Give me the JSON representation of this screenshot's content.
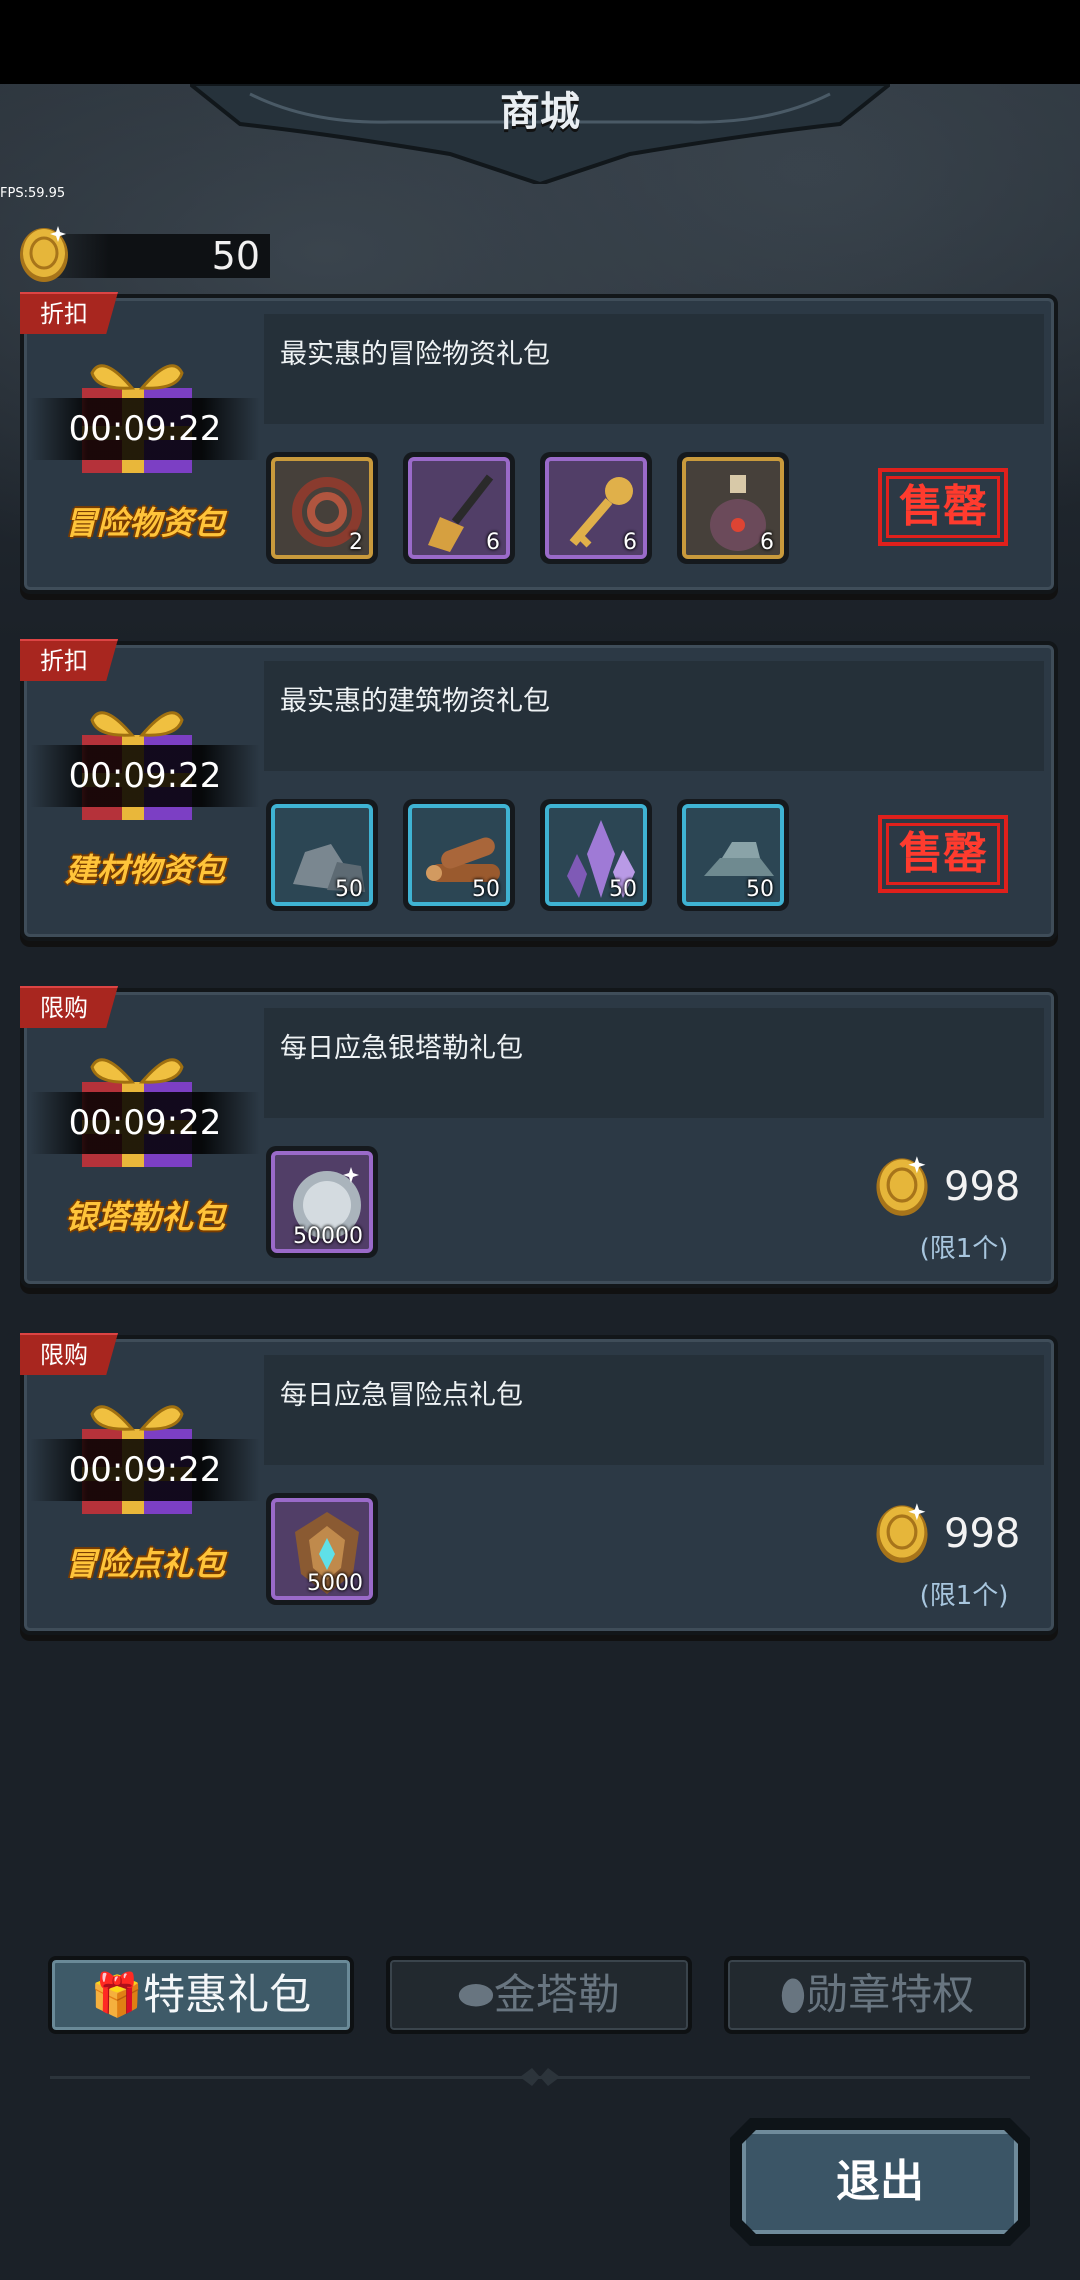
{
  "header": {
    "title": "商城",
    "fps": "FPS:59.95"
  },
  "currency": {
    "amount": "50",
    "icon": "gold-coin-icon"
  },
  "packs": [
    {
      "tag": "折扣",
      "timer": "00:09:22",
      "name": "冒险物资包",
      "description": "最实惠的冒险物资礼包",
      "items": [
        {
          "icon": "rope-icon",
          "count": "2",
          "frame": "gold"
        },
        {
          "icon": "shovel-icon",
          "count": "6",
          "frame": "purple"
        },
        {
          "icon": "key-icon",
          "count": "6",
          "frame": "purple"
        },
        {
          "icon": "potion-icon",
          "count": "6",
          "frame": "gold"
        }
      ],
      "status": "售罄"
    },
    {
      "tag": "折扣",
      "timer": "00:09:22",
      "name": "建材物资包",
      "description": "最实惠的建筑物资礼包",
      "items": [
        {
          "icon": "stone-icon",
          "count": "50",
          "frame": "cyan"
        },
        {
          "icon": "wood-icon",
          "count": "50",
          "frame": "cyan"
        },
        {
          "icon": "crystal-icon",
          "count": "50",
          "frame": "cyan"
        },
        {
          "icon": "iron-ingot-icon",
          "count": "50",
          "frame": "cyan"
        }
      ],
      "status": "售罄"
    },
    {
      "tag": "限购",
      "timer": "00:09:22",
      "name": "银塔勒礼包",
      "description": "每日应急银塔勒礼包",
      "items": [
        {
          "icon": "silver-coin-icon",
          "count": "50000",
          "frame": "purple"
        }
      ],
      "price": "998",
      "limit": "(限1个)"
    },
    {
      "tag": "限购",
      "timer": "00:09:22",
      "name": "冒险点礼包",
      "description": "每日应急冒险点礼包",
      "items": [
        {
          "icon": "adventure-badge-icon",
          "count": "5000",
          "frame": "purple"
        }
      ],
      "price": "998",
      "limit": "(限1个)"
    }
  ],
  "tabs": [
    {
      "label": "特惠礼包",
      "icon": "gift-icon",
      "active": true
    },
    {
      "label": "金塔勒",
      "icon": "coin-icon",
      "active": false
    },
    {
      "label": "勋章特权",
      "icon": "medal-icon",
      "active": false
    }
  ],
  "exit_label": "退出",
  "colors": {
    "accent_gold": "#ffc43a",
    "sold_out_red": "#e0201c",
    "panel": "#2c3945",
    "tab_active": "#3e5a68"
  }
}
